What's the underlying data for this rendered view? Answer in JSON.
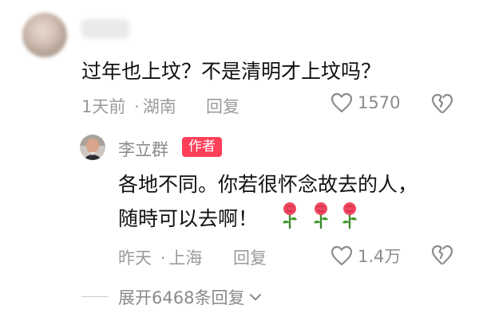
{
  "comment": {
    "text": "过年也上坟？不是清明才上坟吗？",
    "time": "1天前",
    "separator": "·",
    "location": "湖南",
    "reply_label": "回复",
    "like_count": "1570"
  },
  "reply": {
    "author": "李立群",
    "badge": "作者",
    "line1": "各地不同。你若很怀念故去的人，",
    "line2": "随時可以去啊！",
    "emoji": "rose-icon",
    "time": "昨天",
    "separator": "·",
    "location": "上海",
    "reply_label": "回复",
    "like_count": "1.4万"
  },
  "expand": {
    "label": "展开6468条回复"
  },
  "colors": {
    "text_primary": "#111111",
    "text_secondary": "#9b9b9b",
    "badge": "#ff3f58"
  }
}
